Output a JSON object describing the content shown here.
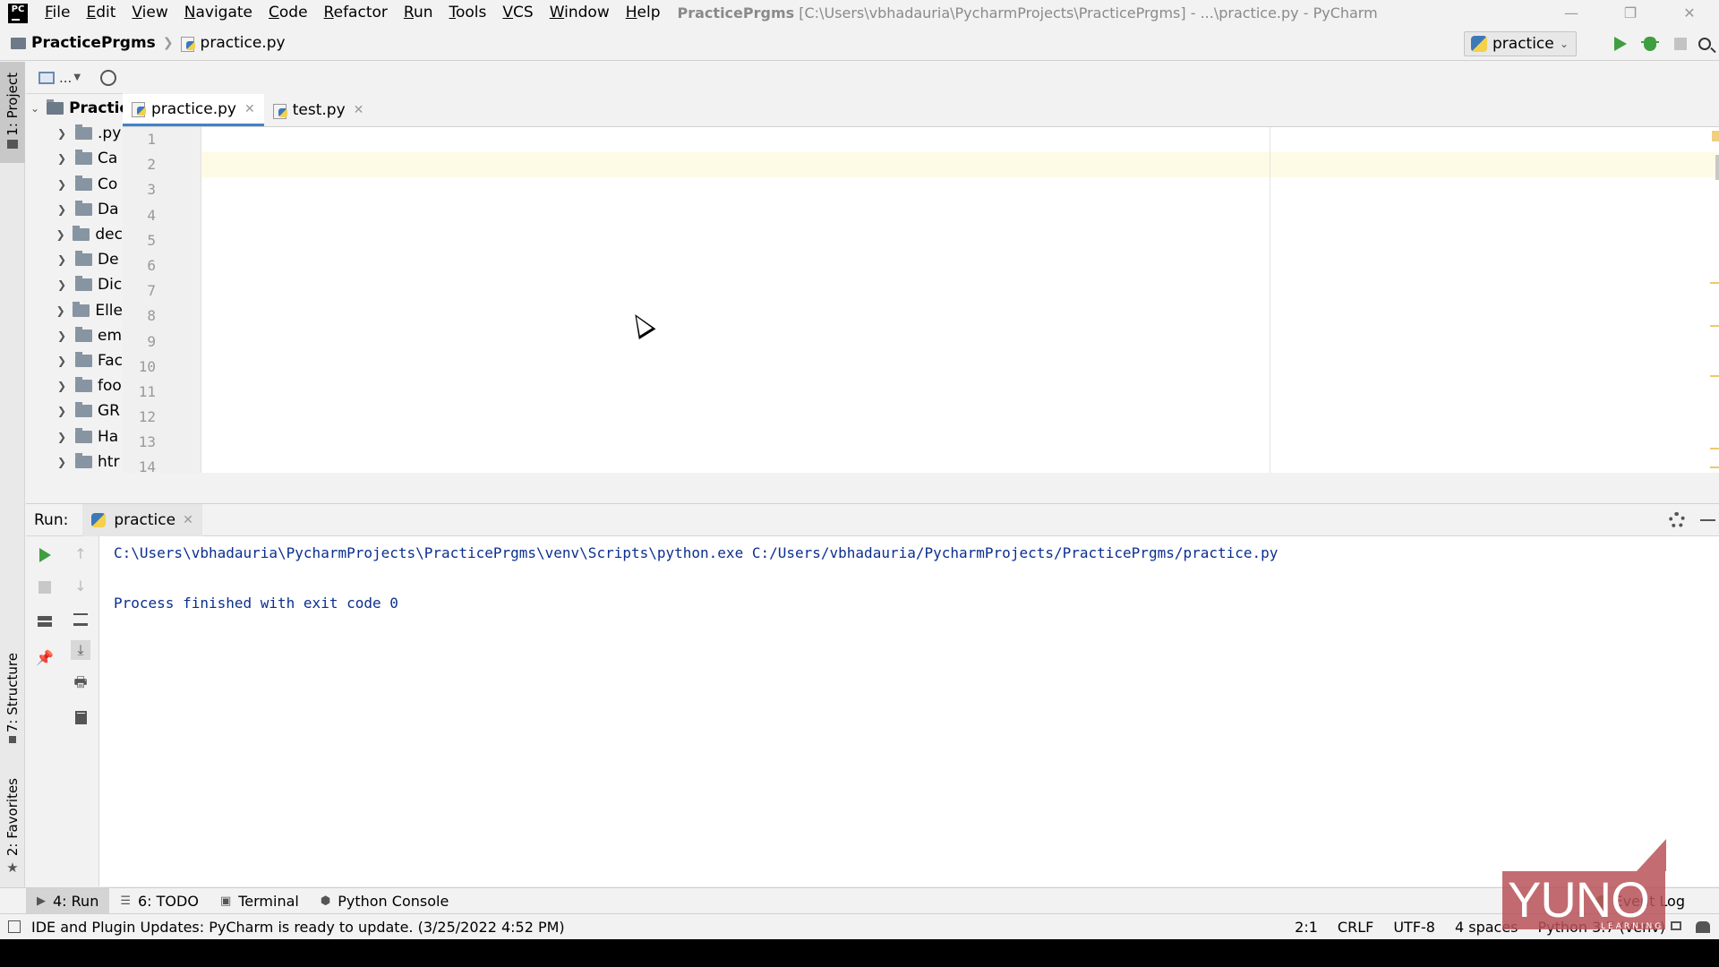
{
  "window": {
    "menu": [
      "File",
      "Edit",
      "View",
      "Navigate",
      "Code",
      "Refactor",
      "Run",
      "Tools",
      "VCS",
      "Window",
      "Help"
    ],
    "title_project": "PracticePrgms",
    "title_rest": " [C:\\Users\\vbhadauria\\PycharmProjects\\PracticePrgms] - ...\\practice.py - PyCharm",
    "app_logo": "PC",
    "controls": [
      "—",
      "❐",
      "✕"
    ]
  },
  "navbar": {
    "project": "PracticePrgms",
    "file": "practice.py",
    "run_config": "practice"
  },
  "left_stripe": {
    "project_tab": "1: Project",
    "structure_tab": "7: Structure",
    "favorites_tab": "2: Favorites"
  },
  "project_panel": {
    "toolbar_dots": "...",
    "items": [
      {
        "label": "PracticePrgms",
        "root": true
      },
      {
        "label": ".py"
      },
      {
        "label": "Ca"
      },
      {
        "label": "Co"
      },
      {
        "label": "Da"
      },
      {
        "label": "dec"
      },
      {
        "label": "De"
      },
      {
        "label": "Dic"
      },
      {
        "label": "Elle"
      },
      {
        "label": "em"
      },
      {
        "label": "Fac"
      },
      {
        "label": "foo"
      },
      {
        "label": "GR"
      },
      {
        "label": "Ha"
      },
      {
        "label": "htr"
      }
    ]
  },
  "editor": {
    "tabs": [
      {
        "label": "practice.py",
        "active": true
      },
      {
        "label": "test.py",
        "active": false
      }
    ],
    "line_numbers": [
      "1",
      "2",
      "3",
      "4",
      "5",
      "6",
      "7",
      "8",
      "9",
      "10",
      "11",
      "12",
      "13",
      "14"
    ]
  },
  "run_window": {
    "label": "Run:",
    "tab": "practice",
    "console": [
      "C:\\Users\\vbhadauria\\PycharmProjects\\PracticePrgms\\venv\\Scripts\\python.exe C:/Users/vbhadauria/PycharmProjects/PracticePrgms/practice.py",
      "",
      "Process finished with exit code 0"
    ]
  },
  "bottom_tools": {
    "run": "4: Run",
    "todo": "6: TODO",
    "terminal": "Terminal",
    "python_console": "Python Console",
    "event_log": "Event Log"
  },
  "statusbar": {
    "message": "IDE and Plugin Updates: PyCharm is ready to update. (3/25/2022 4:52 PM)",
    "position": "2:1",
    "line_sep": "CRLF",
    "encoding": "UTF-8",
    "indent": "4 spaces",
    "interpreter": "Python 3.7 (venv)"
  },
  "watermark": {
    "text": "YUNO",
    "sub": "LEARNING"
  }
}
